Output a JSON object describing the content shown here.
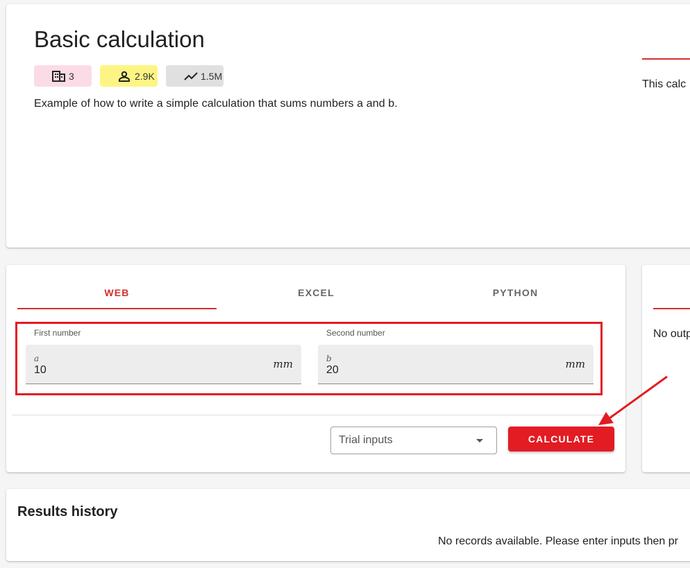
{
  "header": {
    "title": "Basic calculation",
    "chips": [
      {
        "icon": "building-icon",
        "value": "3",
        "color": "#fbdbe6"
      },
      {
        "icon": "person-icon",
        "value": "2.9K",
        "color": "#fcf584"
      },
      {
        "icon": "trending-icon",
        "value": "1.5M",
        "color": "#e0e0e0"
      }
    ],
    "description": "Example of how to write a simple calculation that sums numbers a and b.",
    "side_text": "This calc"
  },
  "tabs": [
    {
      "label": "WEB",
      "active": true
    },
    {
      "label": "EXCEL",
      "active": false
    },
    {
      "label": "PYTHON",
      "active": false
    }
  ],
  "inputs": {
    "a": {
      "label": "First number",
      "symbol": "a",
      "value": "10",
      "unit": "mm"
    },
    "b": {
      "label": "Second number",
      "symbol": "b",
      "value": "20",
      "unit": "mm"
    }
  },
  "actions": {
    "trial_inputs": "Trial inputs",
    "calculate": "CALCULATE"
  },
  "output": {
    "text": "No outp"
  },
  "results": {
    "title": "Results history",
    "empty_text": "No records available. Please enter inputs then pr"
  },
  "colors": {
    "accent": "#d32f2f",
    "button": "#e31b23",
    "annotation": "#e31b23"
  }
}
